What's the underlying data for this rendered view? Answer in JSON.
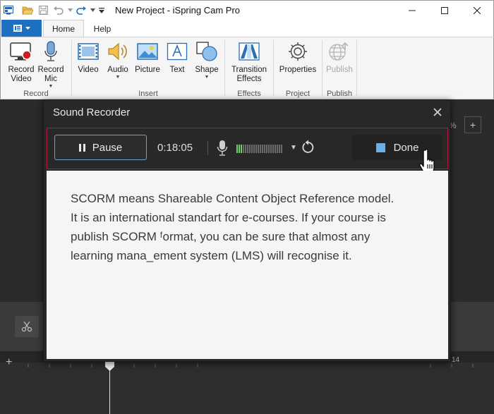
{
  "window": {
    "title": "New Project - iSpring Cam Pro"
  },
  "tabs": [
    {
      "label": "Home",
      "active": true
    },
    {
      "label": "Help",
      "active": false
    }
  ],
  "ribbon": {
    "record": {
      "group_label": "Record",
      "record_video": "Record Video",
      "record_mic": "Record Mic"
    },
    "insert": {
      "group_label": "Insert",
      "video": "Video",
      "audio": "Audio",
      "picture": "Picture",
      "text": "Text",
      "shape": "Shape"
    },
    "effects": {
      "group_label": "Effects",
      "transition": "Transition Effects"
    },
    "project": {
      "group_label": "Project",
      "properties": "Properties"
    },
    "publish": {
      "group_label": "Publish",
      "publish": "Publish",
      "enabled": false
    }
  },
  "workspace": {
    "zoom_suffix": "%",
    "zoom_plus": "+",
    "timeline_plus": "+",
    "timeline_mark": "14"
  },
  "dialog": {
    "title": "Sound Recorder",
    "pause_label": "Pause",
    "timer": "0:18:05",
    "done_label": "Done",
    "meter_level": 0.12,
    "script_text": "SCORM means Shareable Content Object Reference model. It is an international standart for e-courses. If your course is publish SCORM ᶠormat, you can be sure that almost any learning mana_ement system (LMS) will recognise it."
  },
  "colors": {
    "accent": "#1e6fc0",
    "frame_highlight": "#b31b3b",
    "pause_border": "#6aa2d8",
    "meter_active": "#6fcf6f"
  }
}
